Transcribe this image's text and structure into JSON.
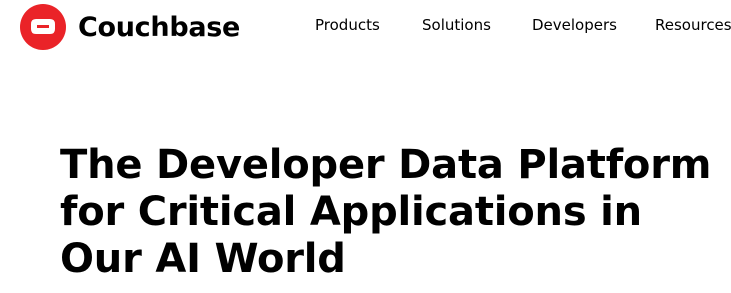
{
  "brand": {
    "name": "Couchbase",
    "logo_icon": "couchbase-logo-icon",
    "accent_color": "#EA2328"
  },
  "nav": {
    "items": [
      {
        "label": "Products"
      },
      {
        "label": "Solutions"
      },
      {
        "label": "Developers"
      },
      {
        "label": "Resources"
      }
    ]
  },
  "hero": {
    "title_lines": [
      "The Developer Data Platform",
      "for Critical Applications in",
      "Our AI World"
    ]
  }
}
